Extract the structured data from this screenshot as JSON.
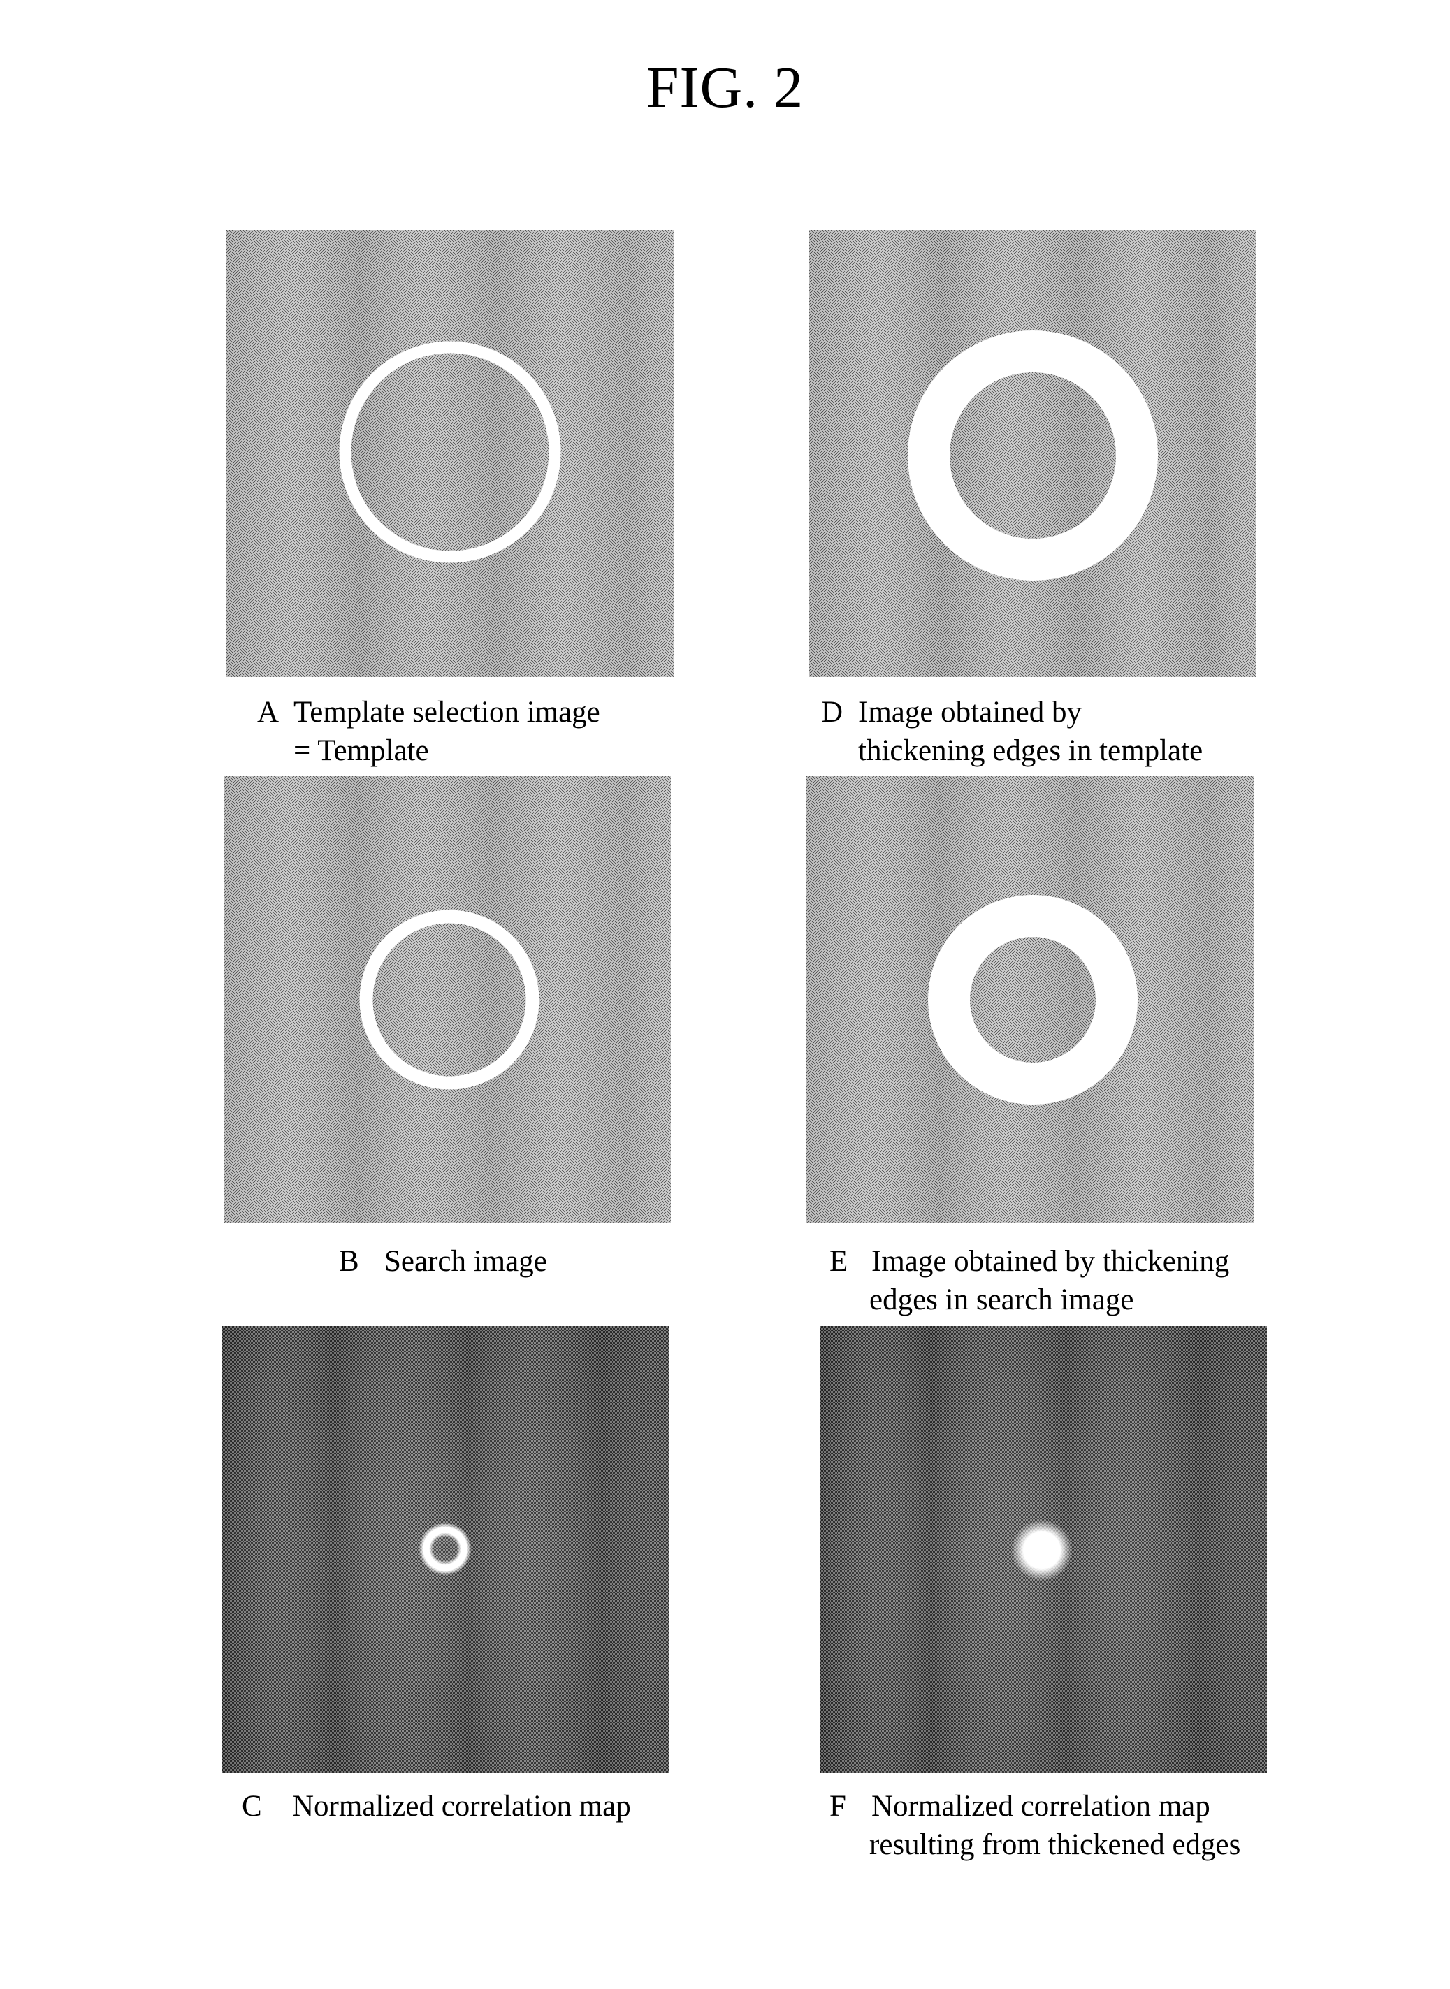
{
  "figure": {
    "title": "FIG. 2"
  },
  "panels": [
    {
      "id": "A",
      "letter": "A",
      "caption_lines": [
        "Template selection image",
        "= Template"
      ],
      "content": "ring",
      "tone": "light",
      "description": "thin bright ring on noisy gray background"
    },
    {
      "id": "D",
      "letter": "D",
      "caption_lines": [
        "Image obtained by",
        "thickening edges in template"
      ],
      "content": "ring",
      "tone": "light",
      "description": "thick bright ring on noisy gray background"
    },
    {
      "id": "B",
      "letter": "B",
      "caption_lines": [
        "Search image"
      ],
      "content": "ring",
      "tone": "light",
      "description": "thin bright ring on noisy gray background"
    },
    {
      "id": "E",
      "letter": "E",
      "caption_lines": [
        "Image obtained by thickening",
        "edges in search image"
      ],
      "content": "ring",
      "tone": "light",
      "description": "thick bright ring on noisy gray background"
    },
    {
      "id": "C",
      "letter": "C",
      "caption_lines": [
        "Normalized correlation map"
      ],
      "content": "small-ring-peak",
      "tone": "dark",
      "description": "small bright ring-shaped peak on dark noisy background"
    },
    {
      "id": "F",
      "letter": "F",
      "caption_lines": [
        "Normalized correlation map",
        "resulting from thickened edges"
      ],
      "content": "disc-peak",
      "tone": "dark",
      "description": "bright solid disc peak on dark noisy background"
    }
  ],
  "colors": {
    "page_bg": "#ffffff",
    "text": "#000000",
    "light_bg": "#b4b4b4",
    "dark_bg": "#767676",
    "highlight": "#ffffff"
  }
}
